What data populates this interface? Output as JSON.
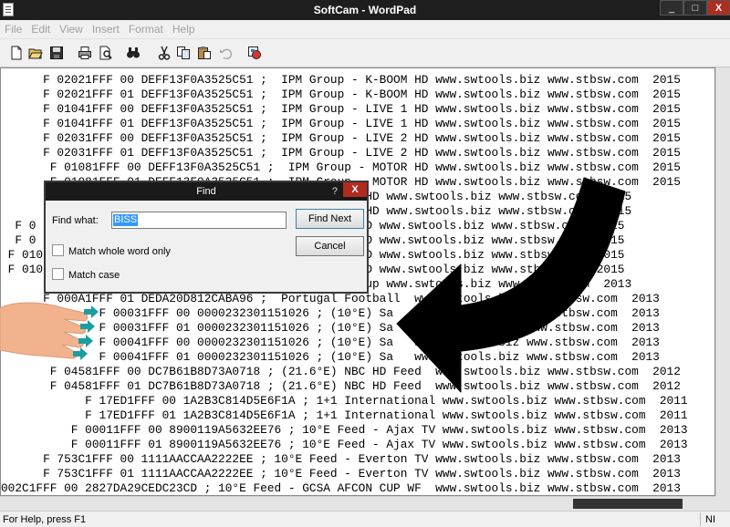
{
  "window": {
    "title": "SoftCam - WordPad",
    "minimize": "_",
    "maximize": "□",
    "close": "X"
  },
  "menu": [
    "File",
    "Edit",
    "View",
    "Insert",
    "Format",
    "Help"
  ],
  "toolbar": {
    "icons": [
      "new-document-icon",
      "open-folder-icon",
      "save-icon",
      "print-icon",
      "print-preview-icon",
      "find-binoculars-icon",
      "cut-scissors-icon",
      "copy-icon",
      "paste-icon",
      "undo-icon",
      "insert-object-icon"
    ]
  },
  "document": {
    "lines": [
      "      F 02021FFF 00 DEFF13F0A3525C51 ;  IPM Group - K-BOOM HD www.swtools.biz www.stbsw.com  2015",
      "      F 02021FFF 01 DEFF13F0A3525C51 ;  IPM Group - K-BOOM HD www.swtools.biz www.stbsw.com  2015",
      "      F 01041FFF 00 DEFF13F0A3525C51 ;  IPM Group - LIVE 1 HD www.swtools.biz www.stbsw.com  2015",
      "      F 01041FFF 01 DEFF13F0A3525C51 ;  IPM Group - LIVE 1 HD www.swtools.biz www.stbsw.com  2015",
      "      F 02031FFF 00 DEFF13F0A3525C51 ;  IPM Group - LIVE 2 HD www.swtools.biz www.stbsw.com  2015",
      "      F 02031FFF 01 DEFF13F0A3525C51 ;  IPM Group - LIVE 2 HD www.swtools.biz www.stbsw.com  2015",
      "       F 01081FFF 00 DEFF13F0A3525C51 ;  IPM Group - MOTOR HD www.swtools.biz www.stbsw.com  2015",
      "       F 01081FFF 01 DEFF13F0A3525C51 ;  IPM Group - MOTOR HD www.swtools.biz www.stbsw.com  2015",
      "                                           - TRAVEL HD www.swtools.biz www.stbsw.com  2015",
      "                                           - TRAVEL HD www.swtools.biz www.stbsw.com  2015",
      "  F 0                                     RITY ONE HD www.swtools.biz www.stbsw.com  2015",
      "  F 0                                     RITY ONE HD www.swtools.biz www.stbsw.com  2015",
      " F 010                                    LD STORY HD www.swtools.biz www.stbsw.com  2015",
      " F 010                                    LD STORY HD www.swtools.biz www.stbsw.com  2015",
      "                                          Football Cup www.swtools.biz www.stbsw.com  2013",
      "      F 000A1FFF 01 DEDA20D812CABA96 ;  Portugal Football  www.swtools.biz www.stbsw.com  2013",
      "              F 00031FFF 00 0000232301151026 ; (10°E) Sa   www.swtools.biz www.stbsw.com  2013",
      "              F 00031FFF 01 0000232301151026 ; (10°E) Sa   www.swtools.biz www.stbsw.com  2013",
      "              F 00041FFF 00 0000232301151026 ; (10°E) Sa   www.swtools.biz www.stbsw.com  2013",
      "              F 00041FFF 01 0000232301151026 ; (10°E) Sa   www.swtools.biz www.stbsw.com  2013",
      "       F 04581FFF 00 DC7B61B8D73A0718 ; (21.6°E) NBC HD Feed  www.swtools.biz www.stbsw.com  2012",
      "       F 04581FFF 01 DC7B61B8D73A0718 ; (21.6°E) NBC HD Feed  www.swtools.biz www.stbsw.com  2012",
      "            F 17ED1FFF 00 1A2B3C814D5E6F1A ; 1+1 International www.swtools.biz www.stbsw.com  2011",
      "            F 17ED1FFF 01 1A2B3C814D5E6F1A ; 1+1 International www.swtools.biz www.stbsw.com  2011",
      "          F 00011FFF 00 8900119A5632EE76 ; 10°E Feed - Ajax TV www.swtools.biz www.stbsw.com  2013",
      "          F 00011FFF 01 8900119A5632EE76 ; 10°E Feed - Ajax TV www.swtools.biz www.stbsw.com  2013",
      "      F 753C1FFF 00 1111AACCAA2222EE ; 10°E Feed - Everton TV www.swtools.biz www.stbsw.com  2013",
      "      F 753C1FFF 01 1111AACCAA2222EE ; 10°E Feed - Everton TV www.swtools.biz www.stbsw.com  2013",
      "002C1FFF 00 2827DA29CEDC23CD ; 10°E Feed - GCSA AFCON CUP WF  www.swtools.biz www.stbsw.com  2013"
    ]
  },
  "find_dialog": {
    "title": "Find",
    "help_icon": "?",
    "close": "X",
    "find_what_label": "Find what:",
    "find_what_value": "BISS",
    "find_next_label": "Find Next",
    "cancel_label": "Cancel",
    "match_whole_word_label": "Match whole word only",
    "match_case_label": "Match case"
  },
  "status": {
    "help_text": "For Help, press F1",
    "mode": "NI"
  },
  "colors": {
    "titlebar": "#1e1e1e",
    "close_button": "#b12b1e",
    "selection": "#3399ff",
    "hand_arrow": "#1a9ea0",
    "big_arrow": "#000000"
  }
}
